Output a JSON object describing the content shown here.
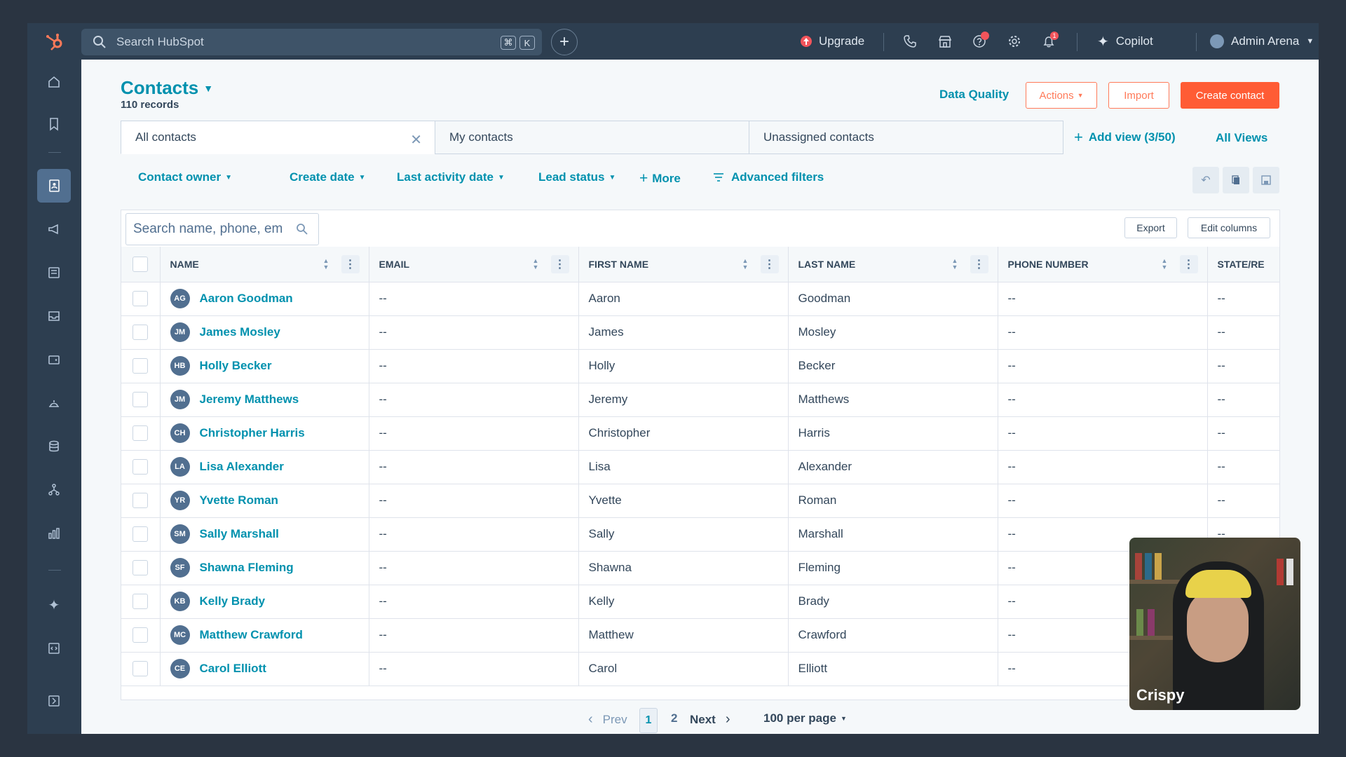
{
  "topbar": {
    "search_placeholder": "Search HubSpot",
    "kbd_cmd": "⌘",
    "kbd_k": "K",
    "upgrade_label": "Upgrade",
    "copilot_label": "Copilot",
    "account_label": "Admin Arena",
    "notification_count": "1"
  },
  "page": {
    "title": "Contacts",
    "record_count": "110 records",
    "data_quality_label": "Data Quality",
    "actions_label": "Actions",
    "import_label": "Import",
    "create_label": "Create contact"
  },
  "views": {
    "tabs": [
      {
        "label": "All contacts"
      },
      {
        "label": "My contacts"
      },
      {
        "label": "Unassigned contacts"
      }
    ],
    "add_view_label": "Add view (3/50)",
    "all_views_label": "All Views"
  },
  "filters": {
    "items": [
      "Contact owner",
      "Create date",
      "Last activity date",
      "Lead status"
    ],
    "more_label": "More",
    "advanced_label": "Advanced filters"
  },
  "table": {
    "search_placeholder": "Search name, phone, em",
    "export_label": "Export",
    "edit_columns_label": "Edit columns",
    "columns": [
      "Name",
      "Email",
      "First Name",
      "Last Name",
      "Phone Number",
      "State/Re"
    ],
    "rows": [
      {
        "initials": "AG",
        "name": "Aaron Goodman",
        "email": "--",
        "first": "Aaron",
        "last": "Goodman",
        "phone": "--",
        "state": "--"
      },
      {
        "initials": "JM",
        "name": "James Mosley",
        "email": "--",
        "first": "James",
        "last": "Mosley",
        "phone": "--",
        "state": "--"
      },
      {
        "initials": "HB",
        "name": "Holly Becker",
        "email": "--",
        "first": "Holly",
        "last": "Becker",
        "phone": "--",
        "state": "--"
      },
      {
        "initials": "JM",
        "name": "Jeremy Matthews",
        "email": "--",
        "first": "Jeremy",
        "last": "Matthews",
        "phone": "--",
        "state": "--"
      },
      {
        "initials": "CH",
        "name": "Christopher Harris",
        "email": "--",
        "first": "Christopher",
        "last": "Harris",
        "phone": "--",
        "state": "--"
      },
      {
        "initials": "LA",
        "name": "Lisa Alexander",
        "email": "--",
        "first": "Lisa",
        "last": "Alexander",
        "phone": "--",
        "state": "--"
      },
      {
        "initials": "YR",
        "name": "Yvette Roman",
        "email": "--",
        "first": "Yvette",
        "last": "Roman",
        "phone": "--",
        "state": "--"
      },
      {
        "initials": "SM",
        "name": "Sally Marshall",
        "email": "--",
        "first": "Sally",
        "last": "Marshall",
        "phone": "--",
        "state": "--"
      },
      {
        "initials": "SF",
        "name": "Shawna Fleming",
        "email": "--",
        "first": "Shawna",
        "last": "Fleming",
        "phone": "--",
        "state": "--"
      },
      {
        "initials": "KB",
        "name": "Kelly Brady",
        "email": "--",
        "first": "Kelly",
        "last": "Brady",
        "phone": "--",
        "state": "--"
      },
      {
        "initials": "MC",
        "name": "Matthew Crawford",
        "email": "--",
        "first": "Matthew",
        "last": "Crawford",
        "phone": "--",
        "state": "--"
      },
      {
        "initials": "CE",
        "name": "Carol Elliott",
        "email": "--",
        "first": "Carol",
        "last": "Elliott",
        "phone": "--",
        "state": "--"
      }
    ]
  },
  "pagination": {
    "prev_label": "Prev",
    "current_page": "1",
    "page_2": "2",
    "next_label": "Next",
    "per_page_label": "100 per page"
  },
  "webcam": {
    "caption": "Crispy"
  },
  "colors": {
    "accent": "#0091ae",
    "brand": "#ff7a59",
    "nav_bg": "#2d3e50"
  }
}
